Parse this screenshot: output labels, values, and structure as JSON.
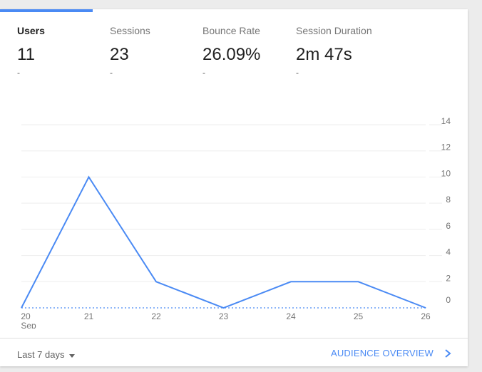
{
  "metrics": [
    {
      "label": "Users",
      "value": "11",
      "change": "-"
    },
    {
      "label": "Sessions",
      "value": "23",
      "change": "-"
    },
    {
      "label": "Bounce Rate",
      "value": "26.09%",
      "change": "-"
    },
    {
      "label": "Session Duration",
      "value": "2m 47s",
      "change": "-"
    }
  ],
  "footer": {
    "range_label": "Last 7 days",
    "link_label": "AUDIENCE OVERVIEW"
  },
  "colors": {
    "accent": "#4a8af4",
    "grid": "#eeeeee"
  },
  "icons": {
    "range_dropdown": "caret-down-icon",
    "link_arrow": "chevron-right-icon"
  },
  "chart_data": {
    "type": "line",
    "x": [
      "20",
      "21",
      "22",
      "23",
      "24",
      "25",
      "26"
    ],
    "x_sublabel": "Sep",
    "series": [
      {
        "values": [
          0,
          10,
          2,
          0,
          2,
          2,
          0
        ]
      }
    ],
    "y_ticks": [
      0,
      2,
      4,
      6,
      8,
      10,
      12,
      14
    ],
    "ylim": [
      0,
      14
    ],
    "grid": true,
    "y_axis_side": "right"
  }
}
